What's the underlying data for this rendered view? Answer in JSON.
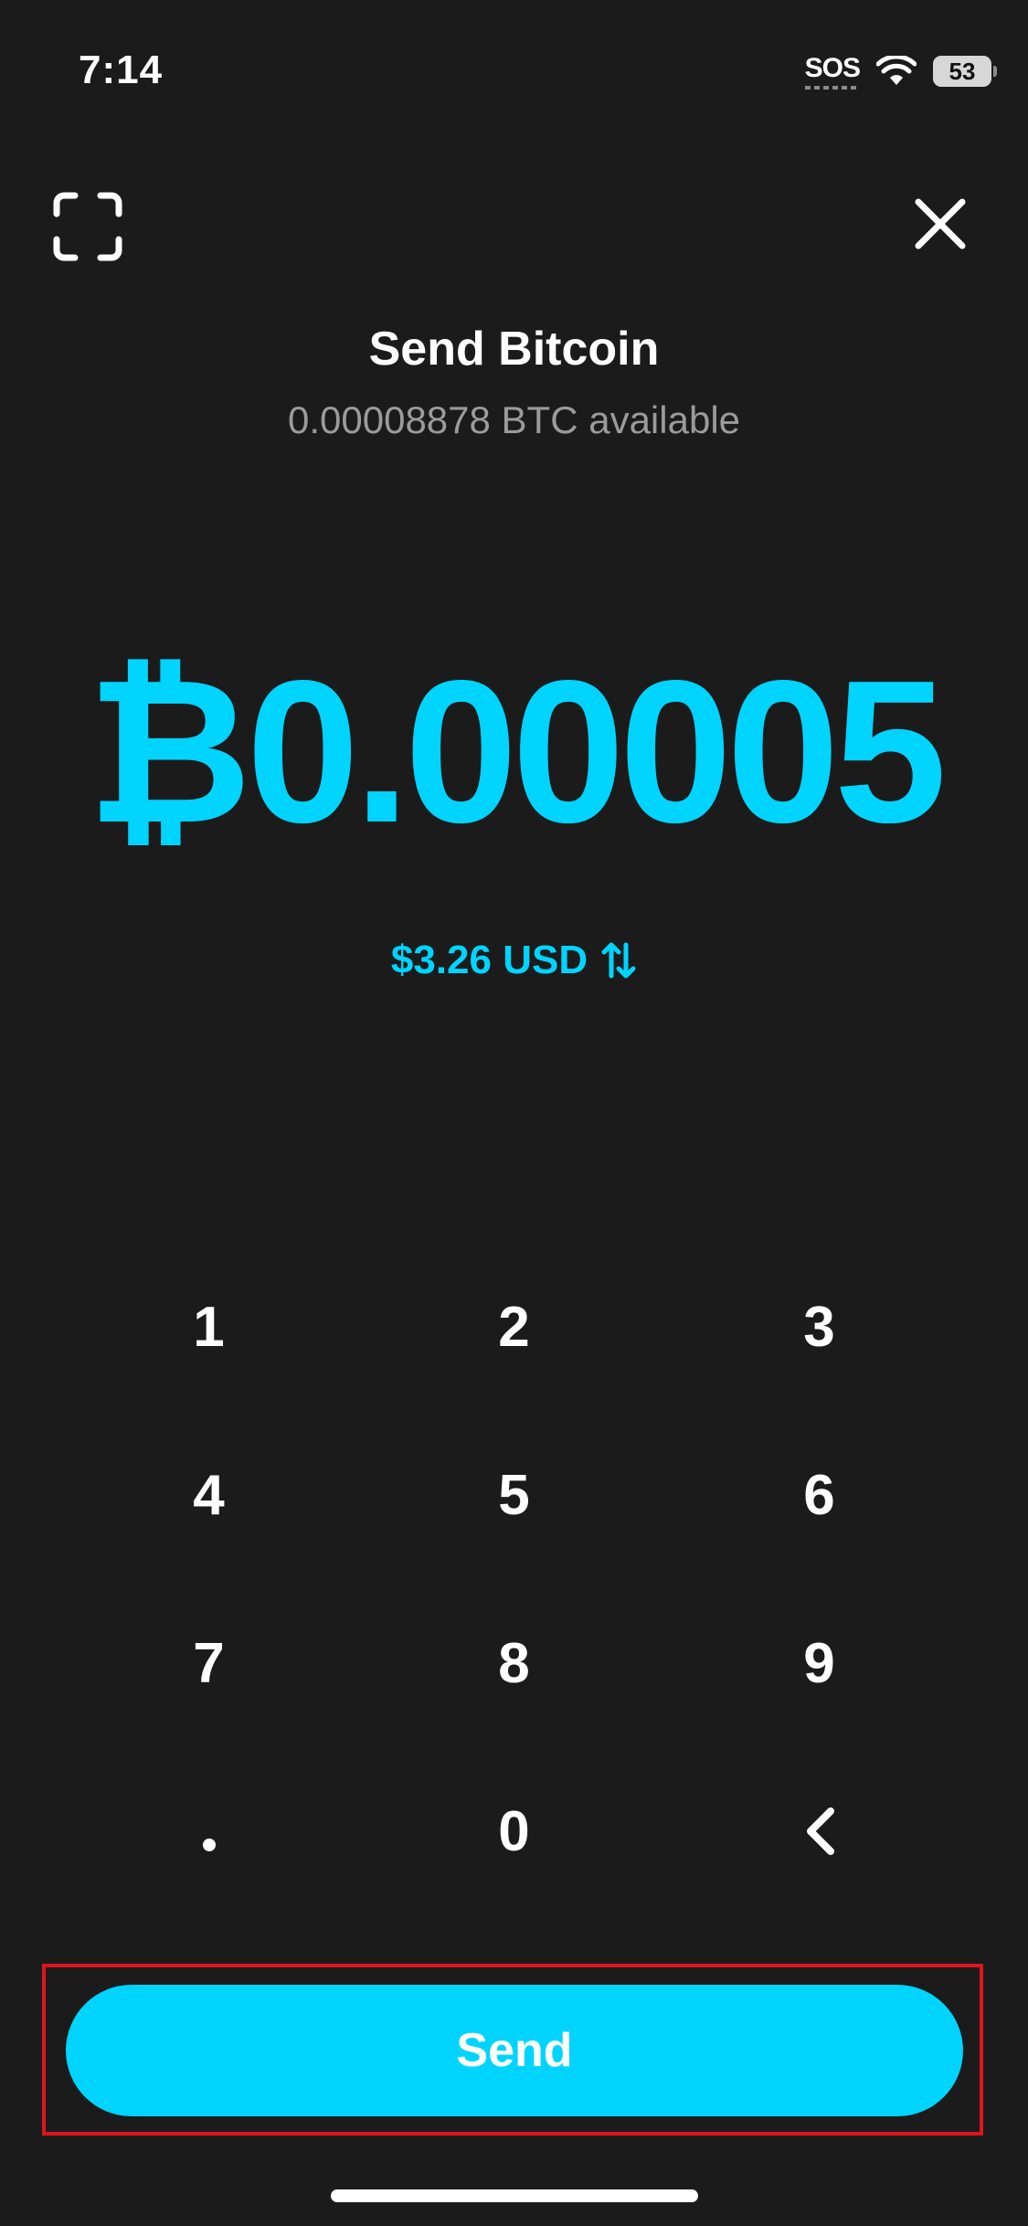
{
  "status_bar": {
    "time": "7:14",
    "sos": "SOS",
    "battery": "53"
  },
  "header": {
    "title": "Send Bitcoin",
    "available": "0.00008878 BTC available"
  },
  "amount": {
    "value": "₿0.00005",
    "fiat": "$3.26 USD"
  },
  "keypad": {
    "k1": "1",
    "k2": "2",
    "k3": "3",
    "k4": "4",
    "k5": "5",
    "k6": "6",
    "k7": "7",
    "k8": "8",
    "k9": "9",
    "k0": "0"
  },
  "send_label": "Send",
  "icons": {
    "scan": "scan-icon",
    "close": "close-icon",
    "swap": "swap-arrows-icon",
    "backspace": "chevron-left-icon",
    "wifi": "wifi-icon"
  },
  "colors": {
    "background": "#1b1b1b",
    "accent": "#00d4ff",
    "highlight_outline": "#e0141e"
  }
}
